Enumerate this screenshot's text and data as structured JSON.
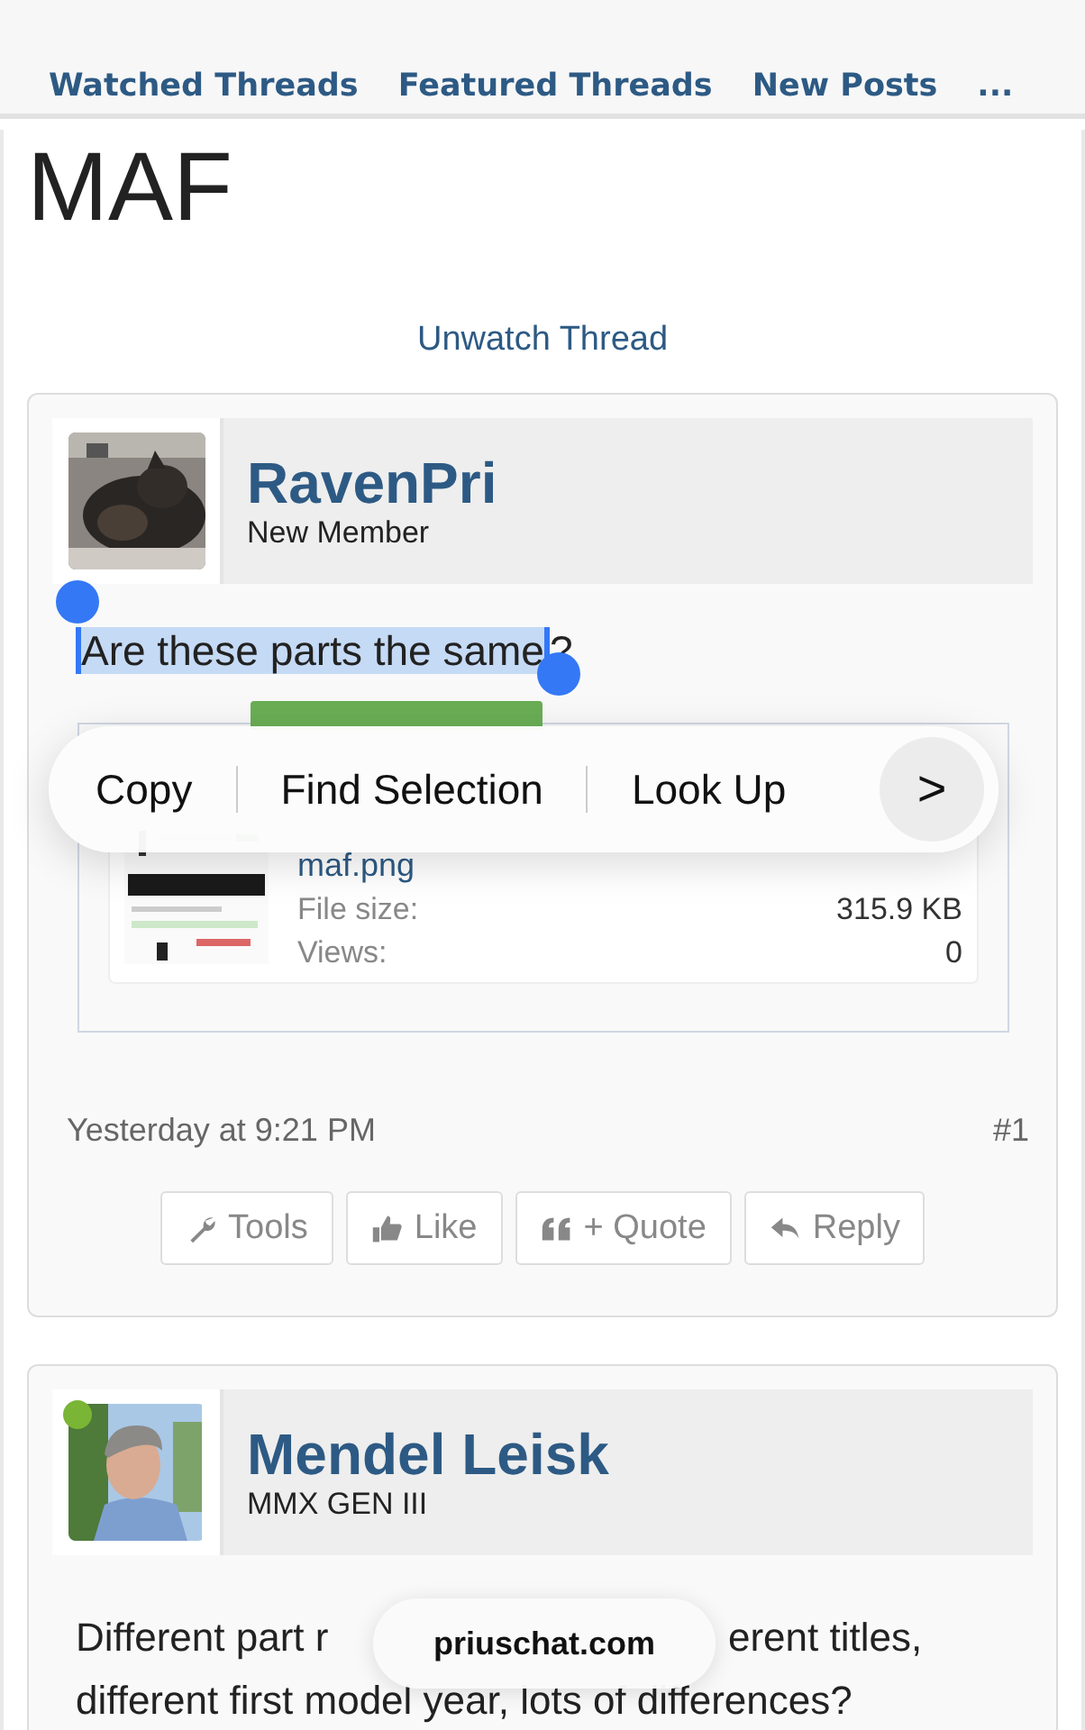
{
  "nav": {
    "links": [
      {
        "label": "Watched Threads"
      },
      {
        "label": "Featured Threads"
      },
      {
        "label": "New Posts"
      },
      {
        "label": "..."
      }
    ]
  },
  "thread": {
    "title": "MAF",
    "watch_link": "Unwatch Thread"
  },
  "posts": [
    {
      "author": "RavenPri",
      "role": "New Member",
      "body": {
        "selected_text": "Are these parts the same",
        "rest": "?"
      },
      "attachment": {
        "file_name": "maf.png",
        "size_label": "File size:",
        "size": "315.9 KB",
        "views_label": "Views:",
        "views": "0"
      },
      "date": "Yesterday at 9:21 PM",
      "number": "#1",
      "actions": [
        {
          "kind": "tools",
          "label": "Tools"
        },
        {
          "kind": "like",
          "label": "Like"
        },
        {
          "kind": "quote",
          "label": "+ Quote"
        },
        {
          "kind": "reply",
          "label": "Reply"
        }
      ]
    },
    {
      "author": "Mendel Leisk",
      "role": "MMX GEN III",
      "online": true,
      "body": {
        "line_1_start": "Different part r",
        "line_1_end": "erent titles,",
        "line_2": "different first model year, lots of differences?"
      }
    }
  ],
  "context_menu": {
    "items": [
      {
        "label": "Copy"
      },
      {
        "label": "Find Selection"
      },
      {
        "label": "Look Up"
      }
    ],
    "more": ">"
  },
  "url_pill": {
    "domain": "priuschat.com"
  }
}
